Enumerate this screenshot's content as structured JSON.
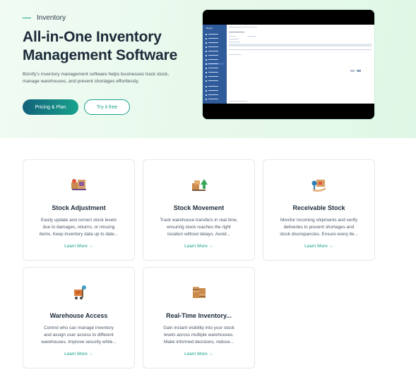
{
  "hero": {
    "eyebrow": "Inventory",
    "title_line1": "All-in-One Inventory",
    "title_line2": "Management Software",
    "description_line1": "Biznify's inventory management software helps businesses track stock,",
    "description_line2": "manage warehouses, and prevent shortages effortlessly.",
    "primary_button": "Pricing & Plan",
    "secondary_button": "Try it free"
  },
  "preview": {
    "brand": "Biznify"
  },
  "cards": [
    {
      "title": "Stock Adjustment",
      "desc": [
        "Easily update and correct stock levels",
        "due to damages, returns, or missing",
        "items. Keep inventory data up to date..."
      ],
      "link": "Learn More →",
      "icon": "adjustment-icon"
    },
    {
      "title": "Stock Movement",
      "desc": [
        "Track warehouse transfers in real time,",
        "ensuring stock reaches the right",
        "location without delays. Avoid..."
      ],
      "link": "Learn More →",
      "icon": "movement-icon"
    },
    {
      "title": "Receivable Stock",
      "desc": [
        "Monitor incoming shipments and verify",
        "deliveries to prevent shortages and",
        "stock discrepancies. Ensure every ite..."
      ],
      "link": "Learn More →",
      "icon": "receivable-icon"
    },
    {
      "title": "Warehouse Access",
      "desc": [
        "Control who can manage inventory",
        "and assign user access to different",
        "warehouses. Improve security while..."
      ],
      "link": "Learn More →",
      "icon": "warehouse-icon"
    },
    {
      "title": "Real-Time Inventory...",
      "desc": [
        "Gain instant visibility into your stock",
        "levels across multiple warehouses.",
        "Make informed decisions, reduce..."
      ],
      "link": "Learn More →",
      "icon": "realtime-icon"
    }
  ],
  "colors": {
    "accent": "#19a38c",
    "primary_dark": "#12617a",
    "heading": "#1d2b3a"
  }
}
